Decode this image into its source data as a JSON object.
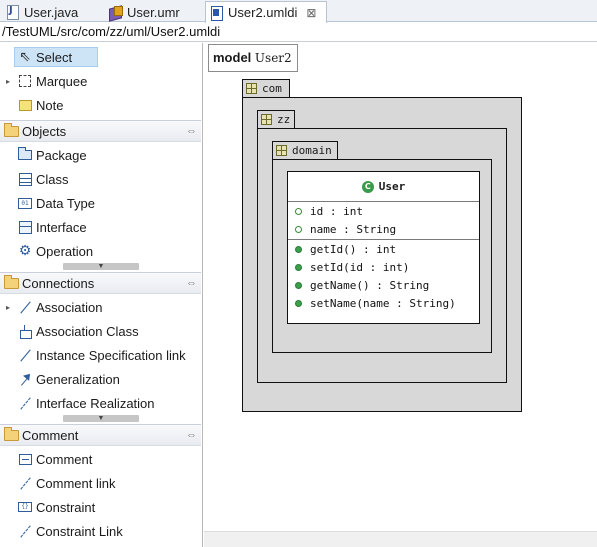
{
  "tabs": [
    {
      "label": "User.java",
      "icon": "java-file-icon",
      "active": false
    },
    {
      "label": "User.umr",
      "icon": "umr-file-icon",
      "active": false
    },
    {
      "label": "User2.umldi",
      "icon": "umldi-file-icon",
      "active": true,
      "close": "⊠"
    }
  ],
  "path": "/TestUML/src/com/zz/uml/User2.umldi",
  "palette": {
    "tools": [
      {
        "label": "Select",
        "icon": "arrow-pointer-icon",
        "selected": true
      },
      {
        "label": "Marquee",
        "icon": "marquee-icon",
        "expandable": true
      },
      {
        "label": "Note",
        "icon": "note-icon"
      }
    ],
    "drawers": [
      {
        "title": "Objects",
        "items": [
          {
            "label": "Package",
            "icon": "package-icon"
          },
          {
            "label": "Class",
            "icon": "class-icon"
          },
          {
            "label": "Data Type",
            "icon": "data-type-icon"
          },
          {
            "label": "Interface",
            "icon": "interface-icon"
          },
          {
            "label": "Operation",
            "icon": "operation-gear-icon"
          }
        ]
      },
      {
        "title": "Connections",
        "items": [
          {
            "label": "Association",
            "icon": "association-icon",
            "expandable": true
          },
          {
            "label": "Association Class",
            "icon": "association-class-icon"
          },
          {
            "label": "Instance Specification link",
            "icon": "instance-link-icon"
          },
          {
            "label": "Generalization",
            "icon": "generalization-icon"
          },
          {
            "label": "Interface Realization",
            "icon": "interface-realization-icon"
          }
        ]
      },
      {
        "title": "Comment",
        "items": [
          {
            "label": "Comment",
            "icon": "comment-icon"
          },
          {
            "label": "Comment link",
            "icon": "comment-link-icon"
          },
          {
            "label": "Constraint",
            "icon": "constraint-icon"
          },
          {
            "label": "Constraint Link",
            "icon": "constraint-link-icon"
          }
        ]
      }
    ]
  },
  "diagram": {
    "model_keyword": "model",
    "model_name": "User2",
    "packages": [
      "com",
      "zz",
      "domain"
    ],
    "class": {
      "name": "User",
      "icon_letter": "C",
      "attributes": [
        "id : int",
        "name : String"
      ],
      "operations": [
        "getId() : int",
        "setId(id : int)",
        "getName() : String",
        "setName(name : String)"
      ]
    }
  },
  "colors": {
    "package_fill": "#d8d8d8",
    "selection": "#cde4f7",
    "class_icon": "#3a9a4a",
    "link_blue": "#2f5d9c"
  }
}
